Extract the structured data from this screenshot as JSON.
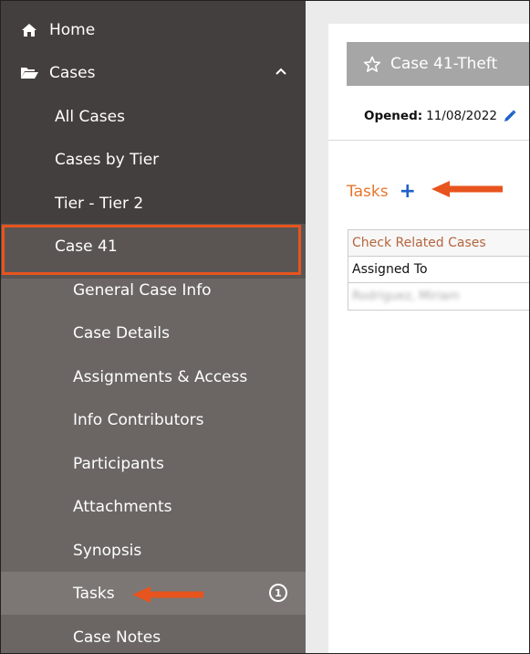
{
  "sidebar": {
    "home": "Home",
    "cases": "Cases",
    "all_cases": "All Cases",
    "cases_by_tier": "Cases by Tier",
    "tier": "Tier - Tier 2",
    "case": "Case 41",
    "sub_items": [
      "General Case Info",
      "Case Details",
      "Assignments & Access",
      "Info Contributors",
      "Participants",
      "Attachments",
      "Synopsis",
      "Tasks",
      "Case Notes"
    ],
    "tasks_badge": "1"
  },
  "main": {
    "case_title": "Case 41-Theft",
    "opened_label": "Opened:",
    "opened_date": "11/08/2022",
    "tasks_title": "Tasks",
    "table": {
      "link_row": "Check Related Cases",
      "header": "Assigned To",
      "blurred_value": "Rodriguez, Miriam"
    }
  },
  "colors": {
    "sidebar_dark": "#433f3e",
    "sidebar_light": "#6b6664",
    "highlight": "#e8541d",
    "tasks_orange": "#e8762c",
    "plus_blue": "#1f61c9"
  }
}
